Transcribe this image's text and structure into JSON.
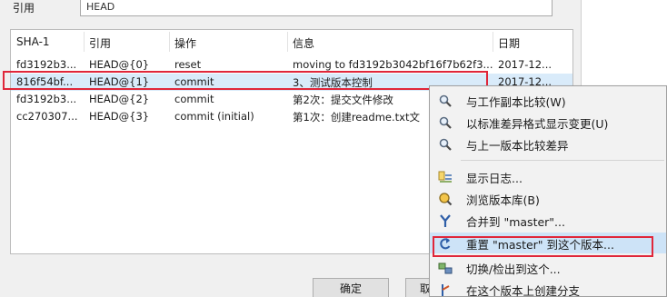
{
  "ref": {
    "label": "引用",
    "value": "HEAD"
  },
  "columns": [
    "SHA-1",
    "引用",
    "操作",
    "信息",
    "日期"
  ],
  "rows": [
    {
      "sha": "fd3192b3...",
      "ref": "HEAD@{0}",
      "op": "reset",
      "msg": "moving to fd3192b3042bf16f7b62f3...",
      "date": "2017-12..."
    },
    {
      "sha": "816f54bf...",
      "ref": "HEAD@{1}",
      "op": "commit",
      "msg": "3、测试版本控制",
      "date": "2017-12..."
    },
    {
      "sha": "fd3192b3...",
      "ref": "HEAD@{2}",
      "op": "commit",
      "msg": "第2次：提交文件修改",
      "date": ""
    },
    {
      "sha": "cc270307...",
      "ref": "HEAD@{3}",
      "op": "commit (initial)",
      "msg": "第1次：创建readme.txt文",
      "date": ""
    }
  ],
  "buttons": {
    "ok": "确定",
    "cancel": "取"
  },
  "menu": {
    "items": [
      {
        "label": "与工作副本比较(W)",
        "icon": "magnifier-icon"
      },
      {
        "label": "以标准差异格式显示变更(U)",
        "icon": "magnifier-icon"
      },
      {
        "label": "与上一版本比较差异",
        "icon": "magnifier-icon"
      },
      {
        "label": "显示日志...",
        "icon": "log-icon"
      },
      {
        "label": "浏览版本库(B)",
        "icon": "repo-browser-icon"
      },
      {
        "label": "合并到 \"master\"...",
        "icon": "merge-icon"
      },
      {
        "label": "重置 \"master\" 到这个版本...",
        "icon": "reset-icon"
      },
      {
        "label": "切换/检出到这个...",
        "icon": "switch-icon"
      },
      {
        "label": "在这个版本上创建分支",
        "icon": "branch-icon"
      }
    ]
  },
  "colors": {
    "selection": "#d9ebfa",
    "highlight_border": "#e0273a",
    "menu_hover": "#cde3f7"
  }
}
